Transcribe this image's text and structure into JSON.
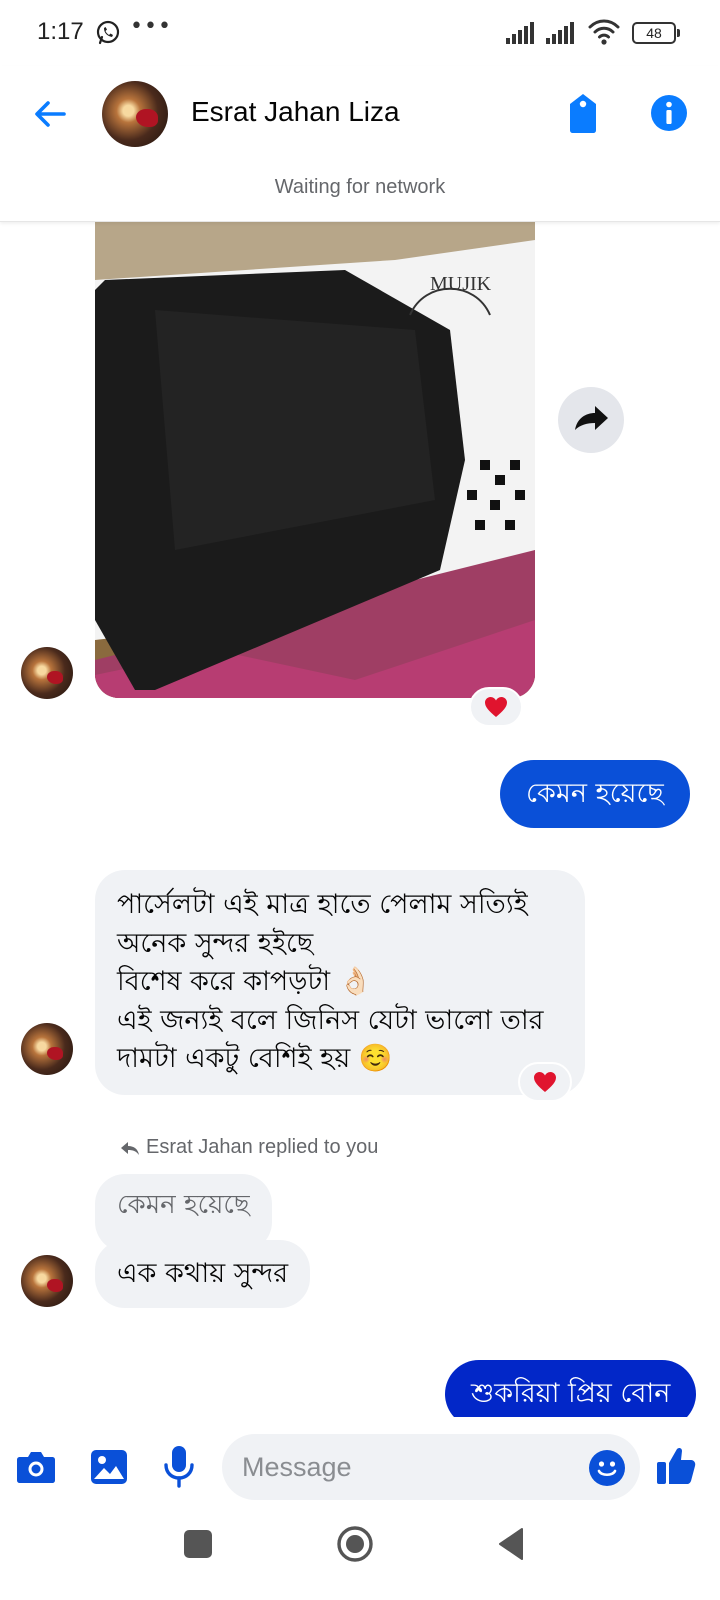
{
  "status_bar": {
    "time": "1:17",
    "dots": "•••",
    "battery": "48"
  },
  "header": {
    "contact_name": "Esrat Jahan Liza",
    "network_status": "Waiting for network"
  },
  "messages": {
    "sent_1": "কেমন হয়েছে",
    "received_1_lines": [
      "পার্সেলটা এই মাত্র হাতে পেলাম সত্যিই",
      "অনেক সুন্দর হইছে",
      "বিশেষ করে কাপড়টা 👌🏻",
      "এই জন্যই বলে জিনিস যেটা ভালো তার",
      "দামটা একটু বেশিই হয় ☺️"
    ],
    "reply_meta": "Esrat Jahan replied to you",
    "quoted_text": "কেমন হয়েছে",
    "reply_text": "এক কথায় সুন্দর",
    "sent_2": "শুকরিয়া প্রিয় বোন",
    "reaction": "heart"
  },
  "composer": {
    "placeholder": "Message",
    "icons": [
      "camera-icon",
      "gallery-icon",
      "mic-icon",
      "emoji-icon",
      "thumbs-up-icon"
    ]
  },
  "colors": {
    "accent": "#0a50d8",
    "sent_bubble": "#0a50d8",
    "sent_bubble_alt": "#0227c8",
    "received_bubble": "#f0f2f5",
    "reaction_heart": "#e0142e",
    "muted_text": "#65676b"
  }
}
